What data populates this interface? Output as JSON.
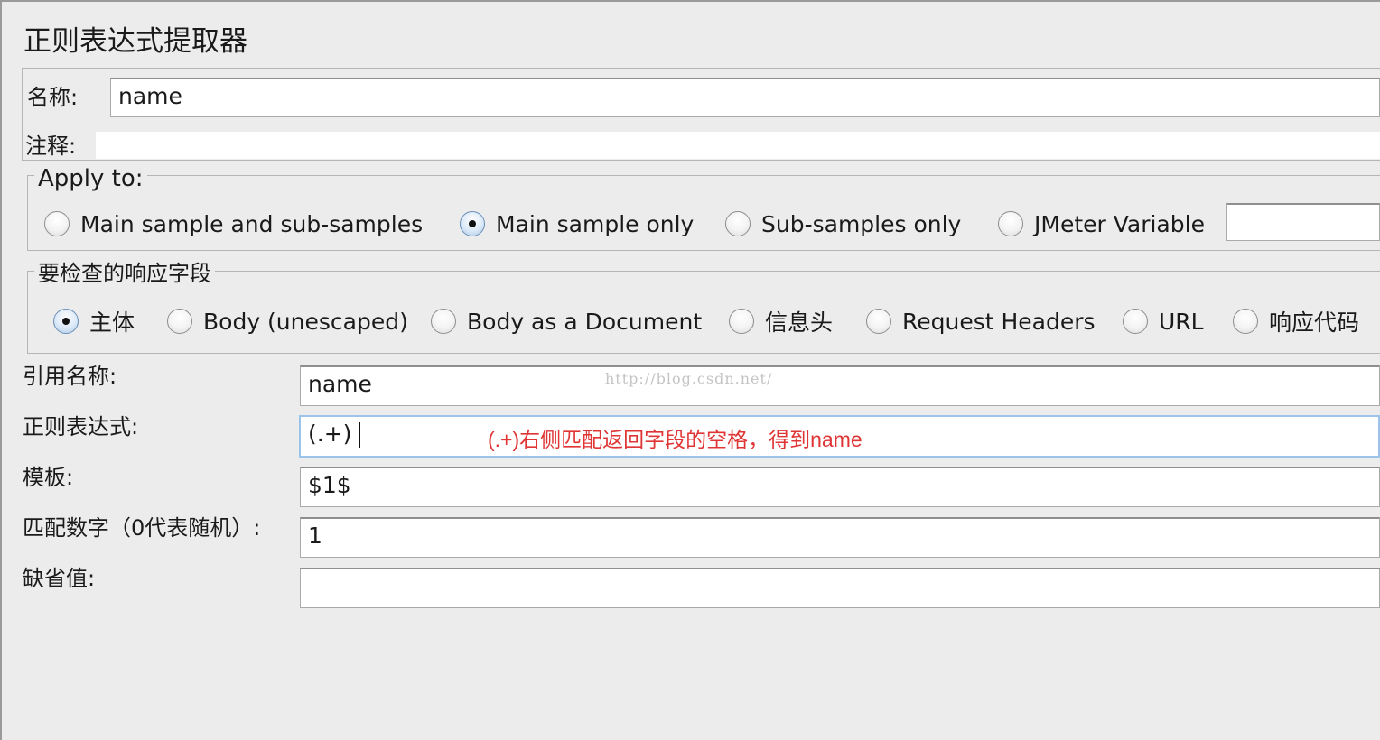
{
  "title": "正则表达式提取器",
  "name_section": {
    "name_label": "名称:",
    "name_value": "name",
    "comment_label": "注释:",
    "comment_value": ""
  },
  "apply_to": {
    "legend": "Apply to:",
    "options": [
      {
        "label": "Main sample and sub-samples",
        "selected": false
      },
      {
        "label": "Main sample only",
        "selected": true
      },
      {
        "label": "Sub-samples only",
        "selected": false
      },
      {
        "label": "JMeter Variable",
        "selected": false
      }
    ],
    "variable_value": ""
  },
  "field_to_check": {
    "legend": "要检查的响应字段",
    "options": [
      {
        "label": "主体",
        "selected": true
      },
      {
        "label": "Body (unescaped)",
        "selected": false
      },
      {
        "label": "Body as a Document",
        "selected": false
      },
      {
        "label": "信息头",
        "selected": false
      },
      {
        "label": "Request Headers",
        "selected": false
      },
      {
        "label": "URL",
        "selected": false
      },
      {
        "label": "响应代码",
        "selected": false
      }
    ]
  },
  "form": {
    "ref_name_label": "引用名称:",
    "ref_name_value": "name",
    "regex_label": "正则表达式:",
    "regex_value": "(.+)",
    "template_label": "模板:",
    "template_value": "$1$",
    "match_no_label": "匹配数字（0代表随机）:",
    "match_no_value": "1",
    "default_label": "缺省值:",
    "default_value": ""
  },
  "annotation": "(.+)右侧匹配返回字段的空格，得到name",
  "watermark": "http://blog.csdn.net/"
}
